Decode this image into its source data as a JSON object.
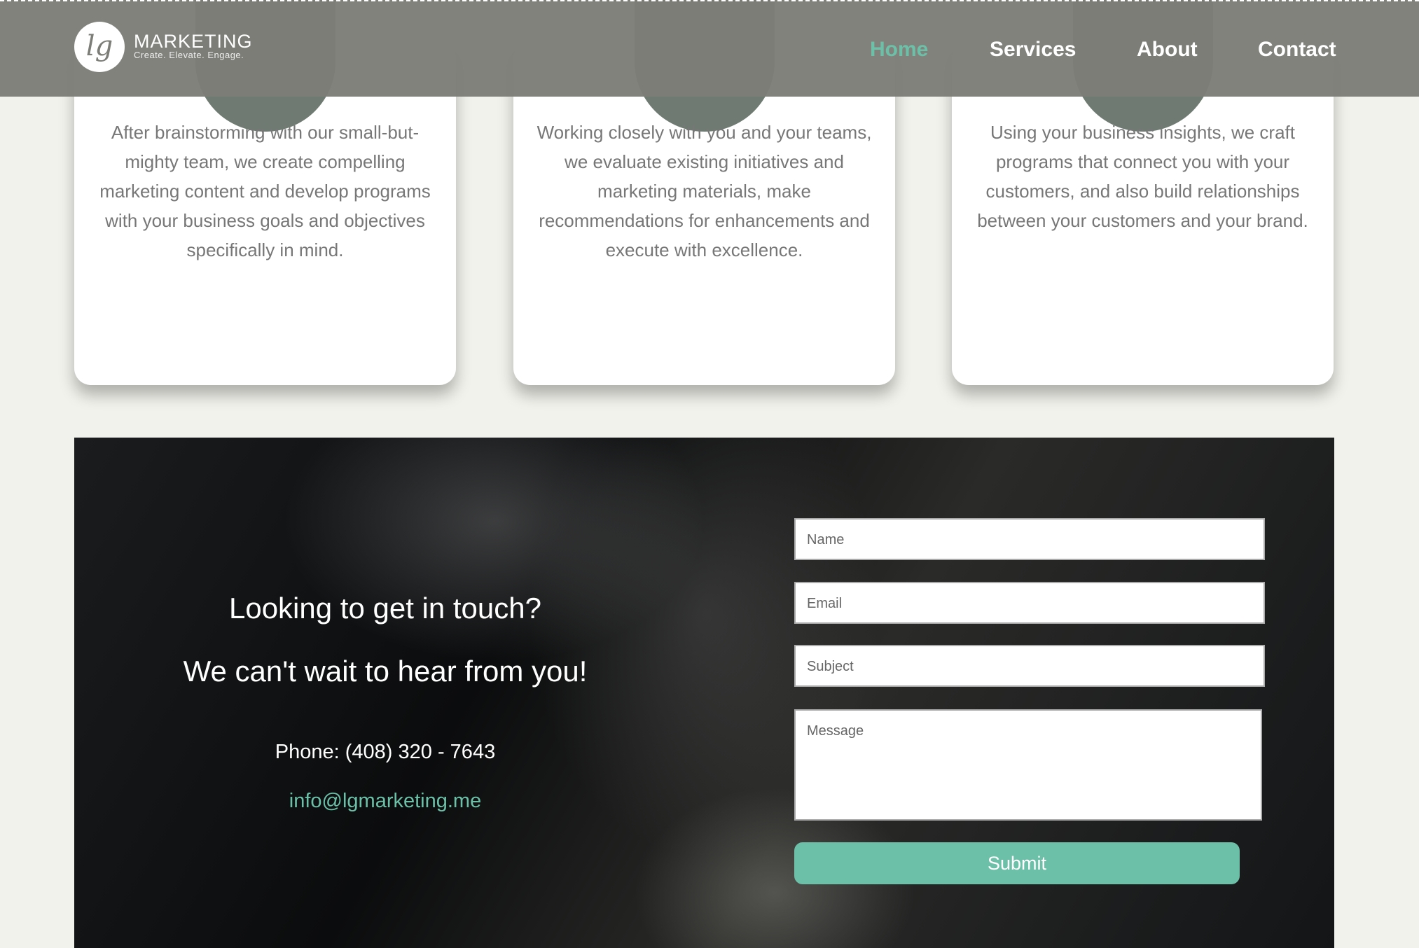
{
  "header": {
    "brand": "MARKETING",
    "tagline": "Create. Elevate. Engage.",
    "logo_letters": "lg",
    "nav": [
      {
        "label": "Home",
        "active": true
      },
      {
        "label": "Services"
      },
      {
        "label": "About"
      },
      {
        "label": "Contact"
      }
    ]
  },
  "colors": {
    "accent": "#6cc0a8",
    "header": "#7c7d77",
    "background": "#f2f2ec"
  },
  "cards": [
    {
      "text": "After brainstorming with our small-but-mighty team, we create compelling marketing content and develop programs with your business goals and objectives specifically in mind.",
      "icon": "lightbulb-icon"
    },
    {
      "text": "Working closely with you and your teams, we evaluate existing initiatives and marketing materials, make recommendations for enhancements and execute with excellence.",
      "icon": "map-icon"
    },
    {
      "text": "Using your business insights, we craft programs that connect you with your customers, and also build relationships between your customers and your brand.",
      "icon": "handshake-icon"
    }
  ],
  "contact": {
    "heading1": "Looking to get in touch?",
    "heading2": "We can't wait to hear from you!",
    "phone": "Phone: (408) 320 - 7643",
    "email": "info@lgmarketing.me",
    "form": {
      "name_placeholder": "Name",
      "email_placeholder": "Email",
      "subject_placeholder": "Subject",
      "message_placeholder": "Message",
      "submit_label": "Submit"
    }
  }
}
